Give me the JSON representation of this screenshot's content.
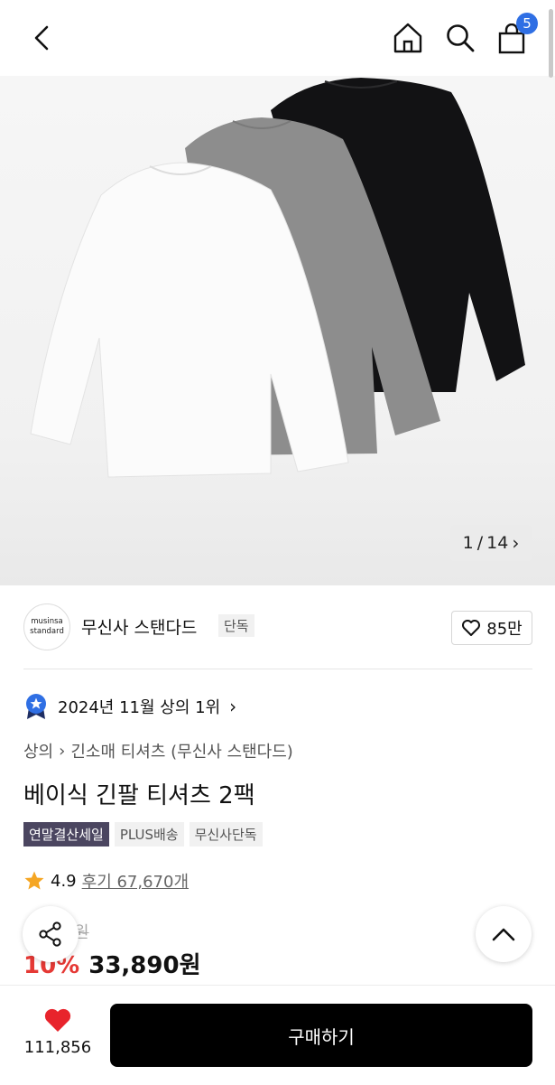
{
  "header": {
    "icons": [
      "back-icon",
      "home-icon",
      "search-icon",
      "cart-icon"
    ],
    "cart_count": "5"
  },
  "gallery": {
    "counter_current": "1",
    "counter_sep": "/",
    "counter_total": "14",
    "next_symbol": "›"
  },
  "brand": {
    "logo_line1": "musinsa",
    "logo_line2": "standard",
    "name": "무신사 스탠다드",
    "tag": "단독",
    "likes": "85만"
  },
  "ranking": {
    "text": "2024년 11월 상의 1위",
    "arrow": "›"
  },
  "breadcrumb": {
    "items": [
      "상의",
      "긴소매 티셔츠 (무신사 스탠다드)"
    ],
    "separator": "›"
  },
  "product": {
    "title": "베이식 긴팔 티셔츠 2팩",
    "tags": [
      "연말결산세일",
      "PLUS배송",
      "무신사단독"
    ],
    "rating": "4.9",
    "reviews": "후기 67,670개",
    "original_price": "원",
    "discount": "10%",
    "price": "33,890원"
  },
  "bottom": {
    "wish_count": "111,856",
    "buy_label": "구매하기"
  },
  "colors": {
    "accent_blue": "#2f6fe4",
    "sale_tag": "#4b4660",
    "discount_red": "#e53935",
    "heart_red": "#e8242c",
    "star_gold": "#f5a623"
  }
}
